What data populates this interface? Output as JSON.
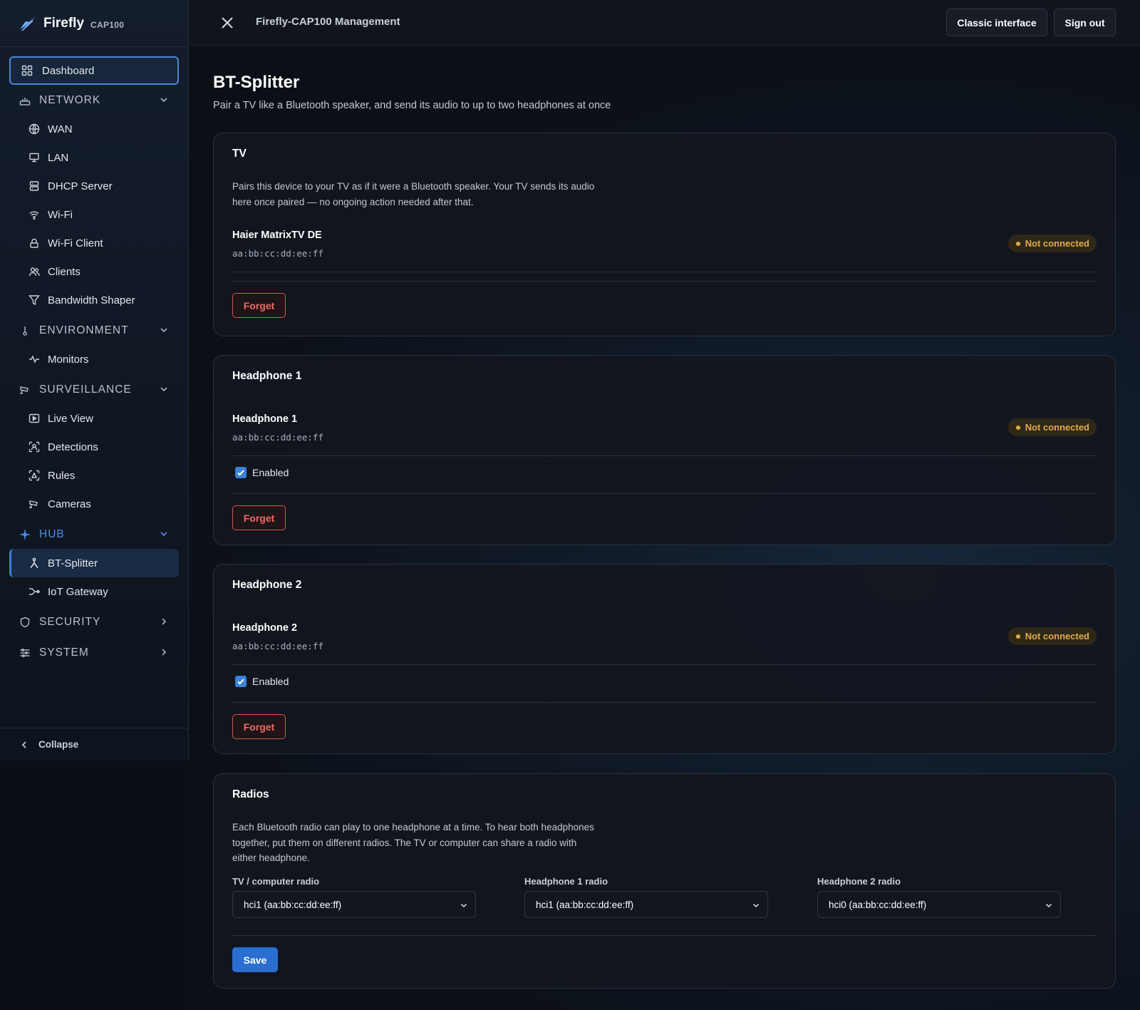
{
  "brand": {
    "name": "Firefly",
    "model": "CAP100",
    "logo_icon": "firefly-logo"
  },
  "colors": {
    "accent": "#3d82d6",
    "danger": "#ef6a63",
    "warning": "#e2a94a",
    "background": "#0b0e14"
  },
  "sidebar": {
    "dashboard": {
      "label": "Dashboard",
      "icon": "grid-icon"
    },
    "network": {
      "label": "NETWORK",
      "items": [
        {
          "label": "WAN",
          "icon": "globe-icon"
        },
        {
          "label": "LAN",
          "icon": "monitor-icon"
        },
        {
          "label": "DHCP Server",
          "icon": "server-icon"
        },
        {
          "label": "Wi-Fi",
          "icon": "wifi-icon"
        },
        {
          "label": "Wi-Fi Client",
          "icon": "wifi-client-icon"
        },
        {
          "label": "Clients",
          "icon": "users-icon"
        },
        {
          "label": "Bandwidth Shaper",
          "icon": "filter-icon"
        }
      ]
    },
    "environment": {
      "label": "ENVIRONMENT",
      "items": [
        {
          "label": "Monitors",
          "icon": "pulse-icon"
        }
      ]
    },
    "surveillance": {
      "label": "SURVEILLANCE",
      "items": [
        {
          "label": "Live View",
          "icon": "play-icon"
        },
        {
          "label": "Detections",
          "icon": "scan-face-icon"
        },
        {
          "label": "Rules",
          "icon": "scan-rules-icon"
        },
        {
          "label": "Cameras",
          "icon": "cctv-icon"
        }
      ]
    },
    "hub": {
      "label": "HUB",
      "items": [
        {
          "label": "BT-Splitter",
          "icon": "split-icon",
          "active": true
        },
        {
          "label": "IoT Gateway",
          "icon": "gateway-icon"
        }
      ]
    },
    "security": {
      "label": "SECURITY"
    },
    "system": {
      "label": "SYSTEM"
    },
    "collapse": {
      "label": "Collapse"
    }
  },
  "topbar": {
    "title": "Firefly-CAP100 Management",
    "classic_label": "Classic interface",
    "signout_label": "Sign out"
  },
  "page": {
    "title": "BT-Splitter",
    "subtitle": "Pair a TV like a Bluetooth speaker, and send its audio to up to two headphones at once"
  },
  "tv_card": {
    "title": "TV",
    "description_line1": "Pairs this device to your TV as if it were a Bluetooth speaker. Your TV sends its audio",
    "description_line2": "here once paired — no ongoing action needed after that.",
    "device_name": "Haier MatrixTV DE",
    "mac": "aa:bb:cc:dd:ee:ff",
    "status": "Not connected",
    "forget_label": "Forget"
  },
  "headphone1_card": {
    "title": "Headphone 1",
    "device_name": "Headphone 1",
    "mac": "aa:bb:cc:dd:ee:ff",
    "status": "Not connected",
    "enabled_label": "Enabled",
    "enabled": true,
    "forget_label": "Forget"
  },
  "headphone2_card": {
    "title": "Headphone 2",
    "device_name": "Headphone 2",
    "mac": "aa:bb:cc:dd:ee:ff",
    "status": "Not connected",
    "enabled_label": "Enabled",
    "enabled": true,
    "forget_label": "Forget"
  },
  "radios_card": {
    "title": "Radios",
    "description_line1": "Each Bluetooth radio can play to one headphone at a time. To hear both headphones",
    "description_line2": "together, put them on different radios. The TV or computer can share a radio with",
    "description_line3": "either headphone.",
    "selects": [
      {
        "label": "TV / computer radio",
        "value": "hci1 (aa:bb:cc:dd:ee:ff)"
      },
      {
        "label": "Headphone 1 radio",
        "value": "hci1 (aa:bb:cc:dd:ee:ff)"
      },
      {
        "label": "Headphone 2 radio",
        "value": "hci0 (aa:bb:cc:dd:ee:ff)"
      }
    ],
    "save_label": "Save"
  }
}
